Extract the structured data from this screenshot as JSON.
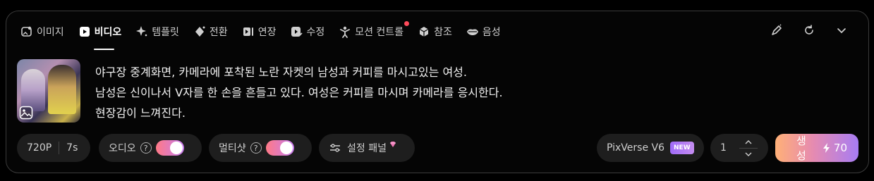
{
  "tabs": [
    {
      "label": "이미지",
      "icon": "image-sparkle-icon"
    },
    {
      "label": "비디오",
      "icon": "video-play-icon",
      "active": true
    },
    {
      "label": "템플릿",
      "icon": "sparkle-icon"
    },
    {
      "label": "전환",
      "icon": "diamond-transition-icon"
    },
    {
      "label": "연장",
      "icon": "extend-icon"
    },
    {
      "label": "수정",
      "icon": "edit-play-icon"
    },
    {
      "label": "모션 컨트롤",
      "icon": "person-motion-icon",
      "notification": true
    },
    {
      "label": "참조",
      "icon": "cube-icon"
    },
    {
      "label": "음성",
      "icon": "lips-icon"
    }
  ],
  "top_actions": [
    "pen-icon",
    "refresh-icon",
    "chevron-down-icon"
  ],
  "prompt": {
    "lines": [
      "야구장 중계화면, 카메라에 포착된 노란 자켓의 남성과 커피를 마시고있는 여성.",
      "남성은 신이나서 V자를 한 손을 흔들고 있다. 여성은 커피를 마시며 카메라를 응시한다.",
      "현장감이 느껴진다."
    ]
  },
  "controls": {
    "resolution": "720P",
    "duration": "7s",
    "audio_label": "오디오",
    "audio_on": true,
    "multishot_label": "멀티샷",
    "multishot_on": true,
    "help_glyph": "?",
    "settings_label": "설정 패널",
    "model_label": "PixVerse V6",
    "model_badge": "NEW",
    "count": "1",
    "generate_label": "생성",
    "generate_cost": "70"
  },
  "colors": {
    "accent_gradient_start": "#ffb077",
    "accent_gradient_end": "#a77cf3",
    "notification_dot": "#ff4a5a"
  }
}
